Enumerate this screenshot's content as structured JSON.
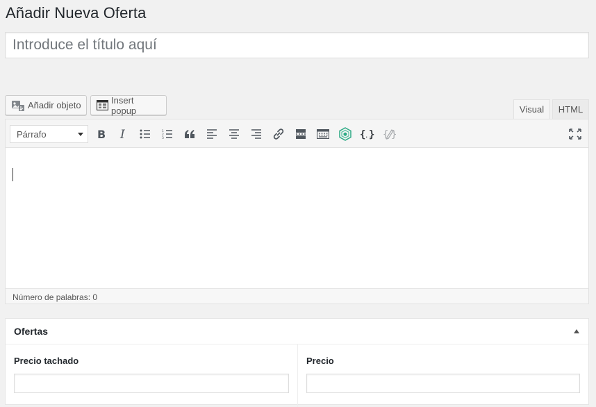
{
  "page": {
    "title": "Añadir Nueva Oferta"
  },
  "title_field": {
    "placeholder": "Introduce el título aquí",
    "value": ""
  },
  "media_buttons": [
    {
      "label": "Añadir objeto",
      "icon": "add-media-icon"
    },
    {
      "label": "Insert popup",
      "icon": "popup-table-icon"
    }
  ],
  "editor_tabs": {
    "visual": "Visual",
    "html": "HTML",
    "active": "Visual"
  },
  "toolbar": {
    "format_select": {
      "value": "Párrafo"
    },
    "buttons": [
      "bold-icon",
      "italic-icon",
      "bulleted-list-icon",
      "numbered-list-icon",
      "blockquote-icon",
      "align-left-icon",
      "align-center-icon",
      "align-right-icon",
      "link-icon",
      "read-more-icon",
      "toolbar-toggle-icon",
      "hexagon-plugin-icon",
      "code-braces-icon",
      "code-edit-icon",
      "fullscreen-icon"
    ]
  },
  "editor": {
    "content": ""
  },
  "status": {
    "word_count": "Número de palabras: 0"
  },
  "metabox": {
    "title": "Ofertas",
    "fields": [
      {
        "label": "Precio tachado",
        "value": ""
      },
      {
        "label": "Precio",
        "value": ""
      }
    ]
  },
  "colors": {
    "background": "#f1f1f1",
    "toolbar": "#f5f5f5",
    "hexagon_icon": "#2eaa85"
  }
}
